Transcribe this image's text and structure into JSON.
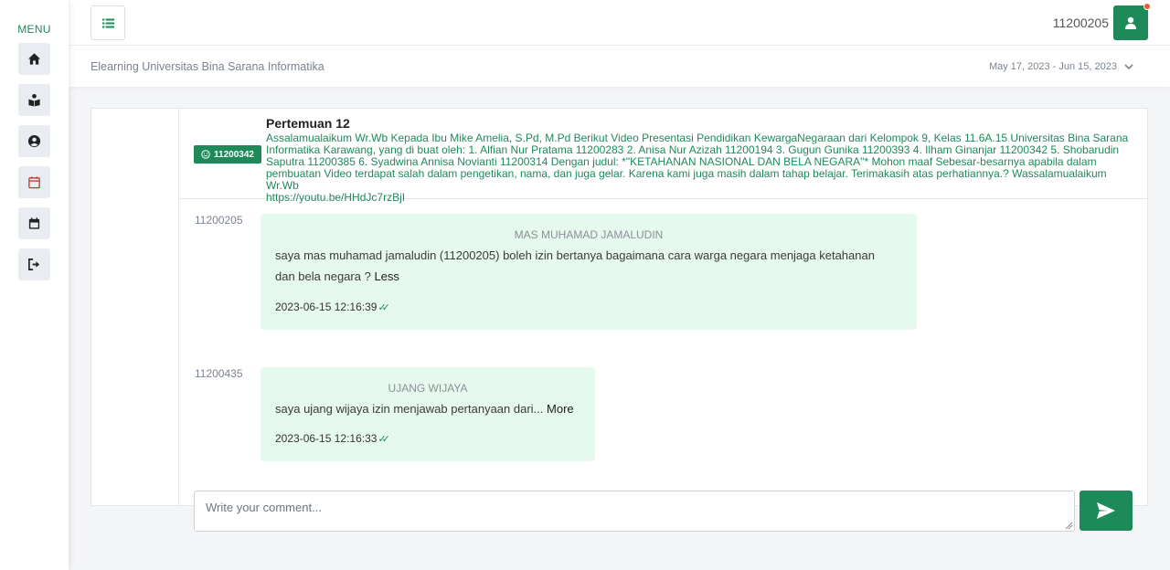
{
  "sidebar": {
    "menu_label": "MENU",
    "items": [
      {
        "name": "home-icon"
      },
      {
        "name": "book-reader-icon"
      },
      {
        "name": "user-circle-icon"
      },
      {
        "name": "calendar-outline-icon"
      },
      {
        "name": "calendar-icon"
      },
      {
        "name": "sign-out-icon"
      }
    ]
  },
  "topbar": {
    "user_id": "11200205",
    "toggle_icon": "list-icon",
    "user_icon": "user-icon"
  },
  "subheader": {
    "site_name": "Elearning Universitas Bina Sarana Informatika",
    "date_range": "May 17, 2023 - Jun 15, 2023"
  },
  "post": {
    "badge": "11200342",
    "title": "Pertemuan 12",
    "body": "Assalamualaikum Wr.Wb Kepada Ibu Mike Amelia, S.Pd, M.Pd Berikut Video Presentasi Pendidikan KewargaNegaraan dari Kelompok 9, Kelas 11.6A.15 Universitas Bina Sarana Informatika Karawang, yang di buat oleh: 1. Alfian Nur Pratama 11200283 2. Anisa Nur Azizah 11200194 3. Gugun Gunika 11200393 4. Ilham Ginanjar 11200342 5. Shobarudin Saputra 11200385 6. Syadwina Annisa Novianti 11200314 Dengan judul: *\"KETAHANAN NASIONAL DAN BELA NEGARA\"* Mohon maaf Sebesar-besarnya apabila dalam pembuatan Video terdapat salah dalam pengetikan, nama, dan juga gelar. Karena kami juga masih dalam tahap belajar. Terimakasih atas perhatiannya.? Wassalamualaikum Wr.Wb",
    "link": "https://youtu.be/HHdJc7rzBjI"
  },
  "messages": [
    {
      "user_id": "11200205",
      "name": "MAS MUHAMAD JAMALUDIN",
      "text": "saya mas muhamad jamaludin (11200205) boleh izin bertanya bagaimana cara warga negara menjaga ketahanan dan bela negara ?",
      "toggle": "Less",
      "time": "2023-06-15 12:16:39",
      "ticks": "✓✓"
    },
    {
      "user_id": "11200435",
      "name": "UJANG WIJAYA",
      "text": "saya ujang wijaya izin menjawab pertanyaan dari...",
      "toggle": "More",
      "time": "2023-06-15 12:16:33",
      "ticks": "✓✓"
    }
  ],
  "comment": {
    "placeholder": "Write your comment..."
  },
  "colors": {
    "accent": "#1e8a5a",
    "bubble": "#e6f9ef",
    "notification": "#f0582f"
  }
}
